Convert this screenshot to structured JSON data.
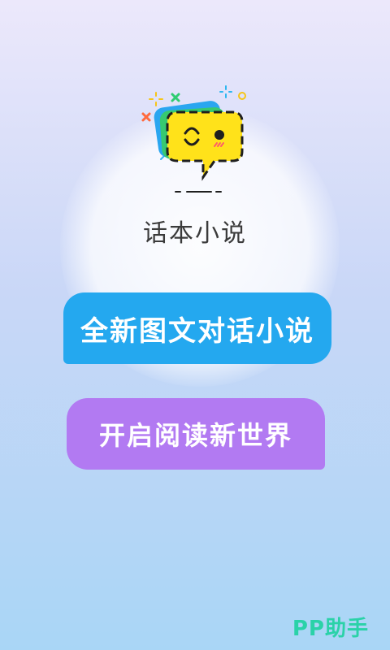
{
  "app": {
    "name": "话本小说"
  },
  "bubbles": {
    "line1": "全新图文对话小说",
    "line2": "开启阅读新世界"
  },
  "watermark": "PP助手",
  "colors": {
    "bubble_blue": "#24a8ef",
    "bubble_purple": "#b27af2",
    "logo_yellow": "#ffe21a",
    "watermark_green": "#2ad2a8"
  }
}
